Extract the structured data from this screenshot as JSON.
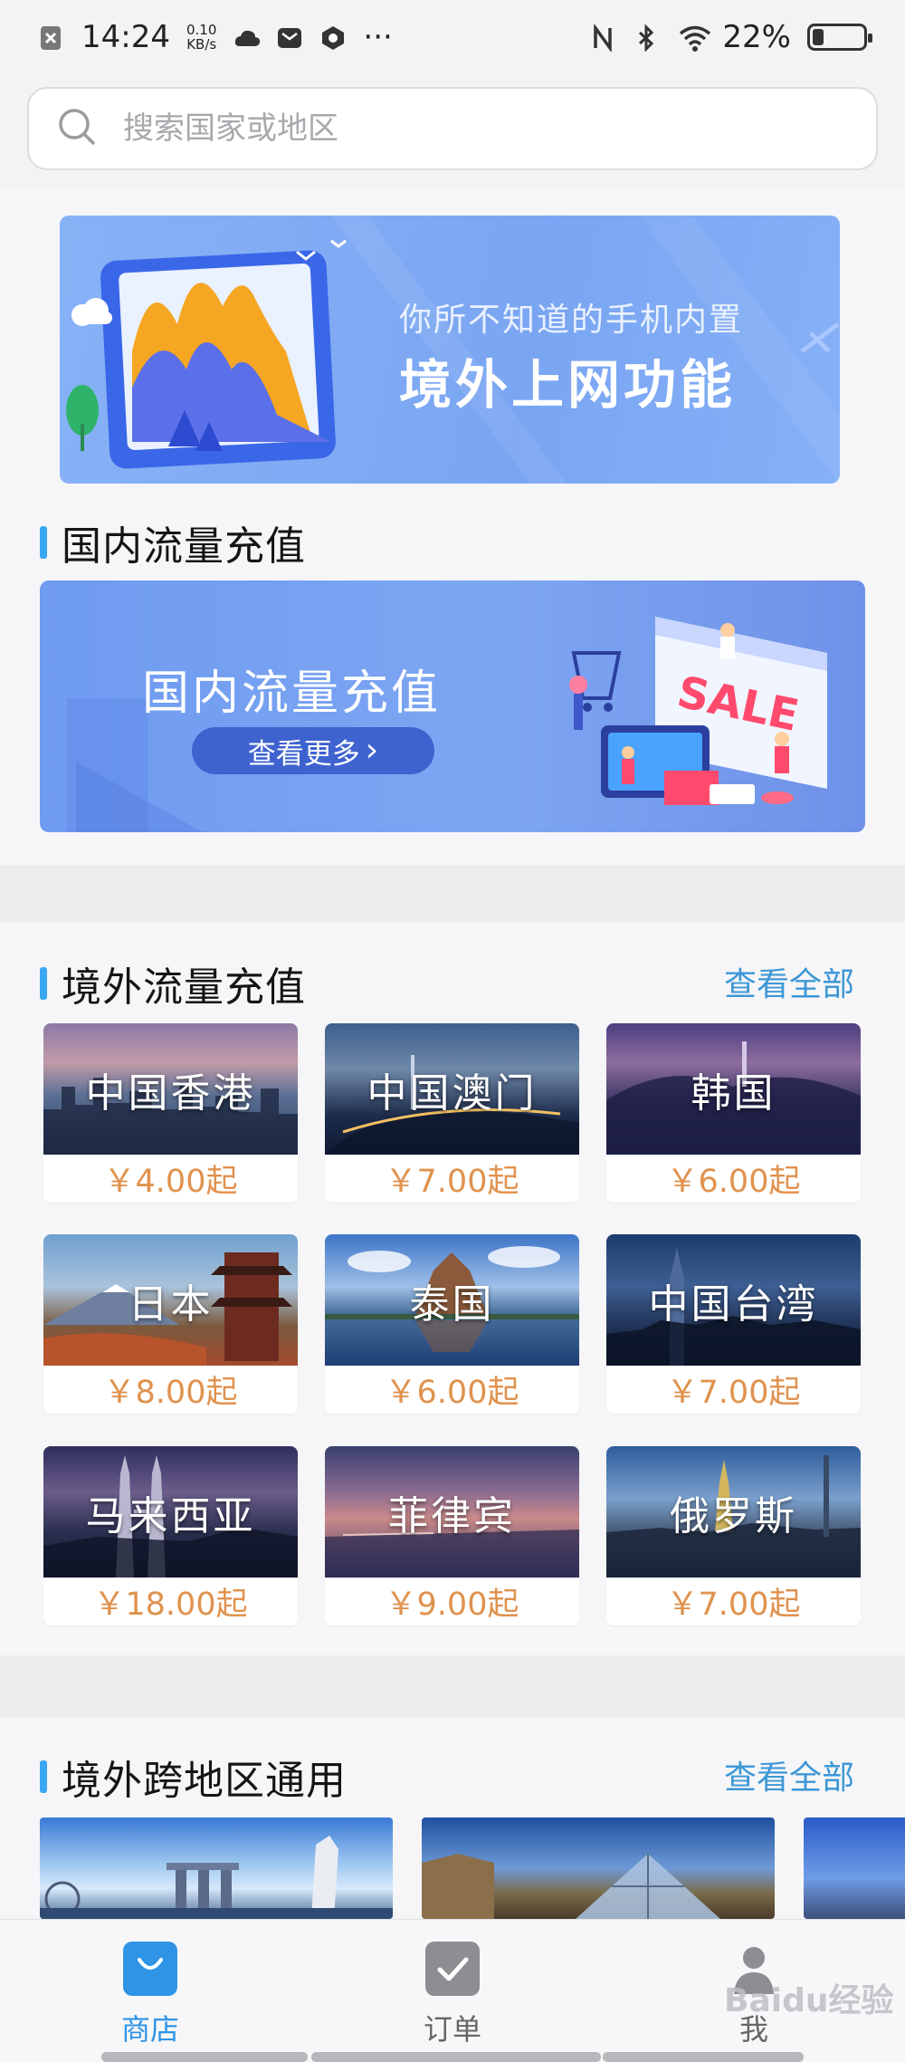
{
  "status_bar": {
    "time": "14:24",
    "net_speed_value": "0.10",
    "net_speed_unit": "KB/s",
    "dots": "···",
    "battery": "22%",
    "battery_level": 0.22
  },
  "search": {
    "placeholder": "搜索国家或地区"
  },
  "banner_top": {
    "line1": "你所不知道的手机内置",
    "line2": "境外上网功能"
  },
  "domestic": {
    "title": "国内流量充值",
    "banner_title": "国内流量充值",
    "banner_button": "查看更多",
    "banner_chevron": "›"
  },
  "overseas": {
    "title": "境外流量充值",
    "see_all": "查看全部",
    "cards": [
      {
        "name": "中国香港",
        "price": "￥4.00起"
      },
      {
        "name": "中国澳门",
        "price": "￥7.00起"
      },
      {
        "name": "韩国",
        "price": "￥6.00起"
      },
      {
        "name": "日本",
        "price": "￥8.00起"
      },
      {
        "name": "泰国",
        "price": "￥6.00起"
      },
      {
        "name": "中国台湾",
        "price": "￥7.00起"
      },
      {
        "name": "马来西亚",
        "price": "￥18.00起"
      },
      {
        "name": "菲律宾",
        "price": "￥9.00起"
      },
      {
        "name": "俄罗斯",
        "price": "￥7.00起"
      }
    ]
  },
  "cross_region": {
    "title": "境外跨地区通用",
    "see_all": "查看全部"
  },
  "tabbar": {
    "tabs": [
      {
        "label": "商店",
        "icon": "shopping-bag-icon",
        "active": true
      },
      {
        "label": "订单",
        "icon": "order-check-icon",
        "active": false
      },
      {
        "label": "我",
        "icon": "person-icon",
        "active": false
      }
    ]
  },
  "watermark": "Baidu经验",
  "colors": {
    "accent": "#3aa7f2",
    "active_tab": "#2f94e6",
    "price": "#e0924e",
    "link": "#3d97d6"
  }
}
